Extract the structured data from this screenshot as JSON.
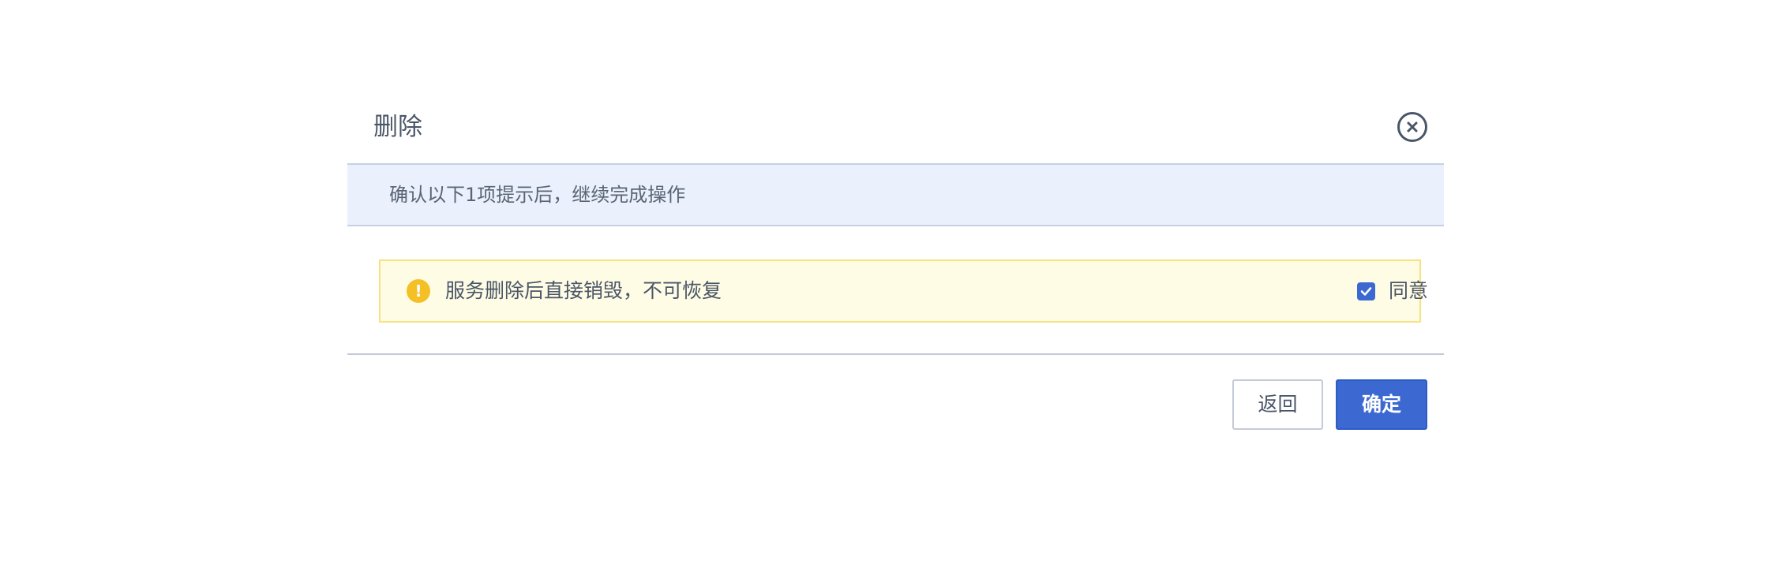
{
  "dialog": {
    "title": "删除",
    "close_icon": "close-circle-icon"
  },
  "notice": {
    "text": "确认以下1项提示后，继续完成操作"
  },
  "warning": {
    "icon": "warning-icon",
    "text": "服务删除后直接销毁，不可恢复",
    "agree_label": "同意",
    "agree_checked": true
  },
  "footer": {
    "back_label": "返回",
    "confirm_label": "确定"
  },
  "colors": {
    "primary": "#3b68d1",
    "notice_bg": "#eaf1fd",
    "warning_bg": "#fefce5",
    "warning_icon": "#f5c026",
    "text": "#4a5668"
  }
}
